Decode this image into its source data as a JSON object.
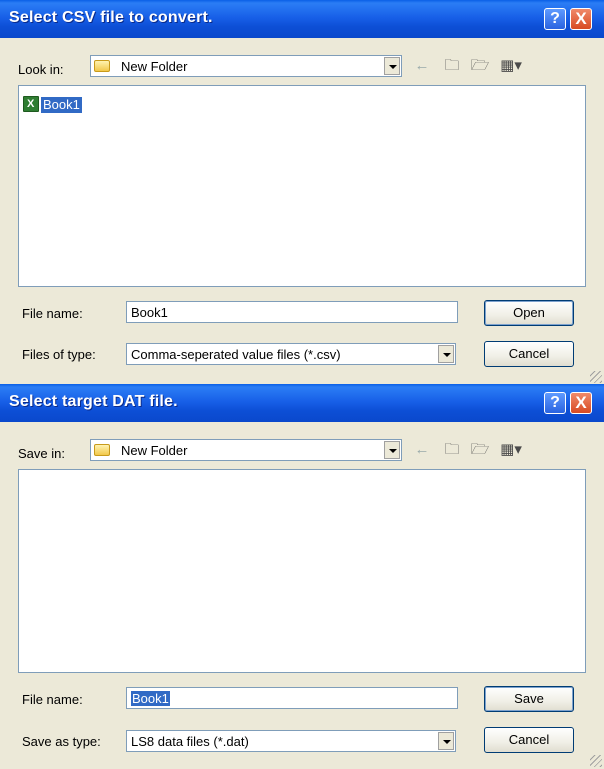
{
  "dialog_open": {
    "title": "Select CSV file to convert.",
    "look_in_label": "Look in:",
    "folder": "New Folder",
    "files": [
      {
        "name": "Book1"
      }
    ],
    "file_name_label": "File name:",
    "file_name_value": "Book1",
    "files_of_type_label": "Files of type:",
    "files_of_type_value": "Comma-seperated value files (*.csv)",
    "primary_button": "Open",
    "cancel_button": "Cancel",
    "help_glyph": "?",
    "close_glyph": "X"
  },
  "dialog_save": {
    "title": "Select target DAT file.",
    "save_in_label": "Save in:",
    "folder": "New Folder",
    "file_name_label": "File name:",
    "file_name_value": "Book1",
    "save_as_type_label": "Save as type:",
    "save_as_type_value": "LS8 data files (*.dat)",
    "primary_button": "Save",
    "cancel_button": "Cancel",
    "help_glyph": "?",
    "close_glyph": "X"
  },
  "toolbar_icons": [
    "back-icon",
    "up-folder-icon",
    "new-folder-icon",
    "view-menu-icon"
  ],
  "colors": {
    "title_bar": "#0a48cc",
    "selection": "#316ac5",
    "dialog_bg": "#ece9d8"
  }
}
